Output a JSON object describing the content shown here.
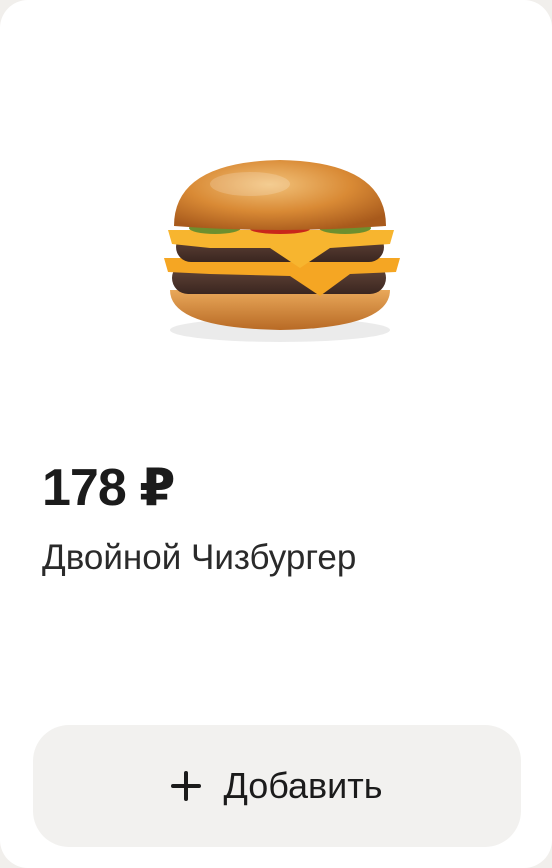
{
  "product": {
    "image": "double-cheeseburger-image",
    "price": "178 ₽",
    "name": "Двойной Чизбургер"
  },
  "actions": {
    "add_label": "Добавить",
    "add_icon": "plus-icon"
  }
}
